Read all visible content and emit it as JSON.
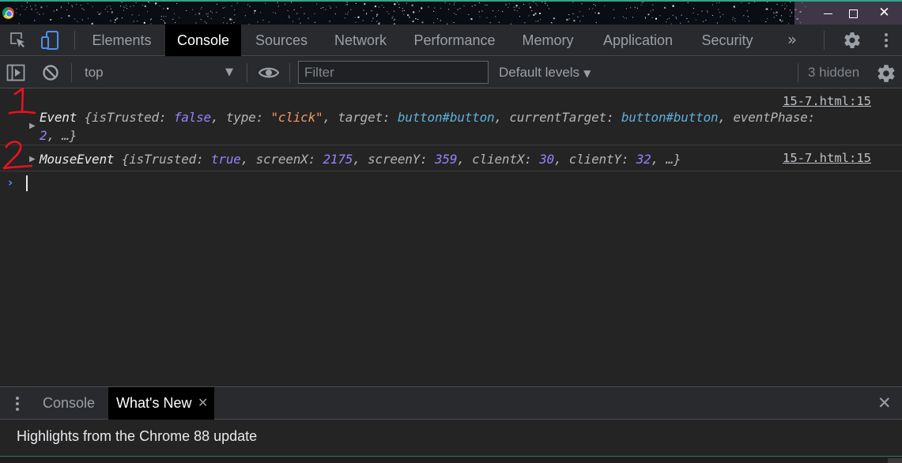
{
  "window": {
    "minimize_icon": "minimize-icon",
    "maximize_icon": "maximize-icon",
    "close_glyph": "✕"
  },
  "tabs": [
    {
      "label": "Elements"
    },
    {
      "label": "Console",
      "active": true
    },
    {
      "label": "Sources"
    },
    {
      "label": "Network"
    },
    {
      "label": "Performance"
    },
    {
      "label": "Memory"
    },
    {
      "label": "Application"
    },
    {
      "label": "Security"
    }
  ],
  "more_tabs_glyph": "»",
  "toolbar": {
    "context": "top",
    "context_arrow": "▼",
    "filter_placeholder": "Filter",
    "filter_value": "",
    "levels_label": "Default levels",
    "levels_caret": "▼",
    "hidden_count": "3 hidden"
  },
  "messages": [
    {
      "source": "15-7.html:15",
      "expand_glyph": "▶",
      "line1": {
        "class_name": "Event",
        "parts": [
          {
            "t": " {",
            "c": "k"
          },
          {
            "t": "isTrusted: ",
            "c": "k"
          },
          {
            "t": "false",
            "c": "f"
          },
          {
            "t": ", type: ",
            "c": "k"
          },
          {
            "t": "\"click\"",
            "c": "s"
          },
          {
            "t": ", target: ",
            "c": "k"
          },
          {
            "t": "button#button",
            "c": "nd"
          },
          {
            "t": ", currentTarget: ",
            "c": "k"
          },
          {
            "t": "button#button",
            "c": "nd"
          },
          {
            "t": ", eventPhase:",
            "c": "k"
          }
        ]
      },
      "line2": {
        "parts": [
          {
            "t": "2",
            "c": "n"
          },
          {
            "t": ", …}",
            "c": "k"
          }
        ]
      }
    },
    {
      "source": "15-7.html:15",
      "expand_glyph": "▶",
      "line1": {
        "class_name": "MouseEvent",
        "parts": [
          {
            "t": " {",
            "c": "k"
          },
          {
            "t": "isTrusted: ",
            "c": "k"
          },
          {
            "t": "true",
            "c": "f"
          },
          {
            "t": ", screenX: ",
            "c": "k"
          },
          {
            "t": "2175",
            "c": "n"
          },
          {
            "t": ", screenY: ",
            "c": "k"
          },
          {
            "t": "359",
            "c": "n"
          },
          {
            "t": ", clientX: ",
            "c": "k"
          },
          {
            "t": "30",
            "c": "n"
          },
          {
            "t": ", clientY: ",
            "c": "k"
          },
          {
            "t": "32",
            "c": "n"
          },
          {
            "t": ", …}",
            "c": "k"
          }
        ]
      }
    }
  ],
  "prompt_glyph": "›",
  "annotations": [
    "1",
    "2"
  ],
  "drawer": {
    "tabs": [
      "Console",
      "What's New"
    ],
    "active_tab": "What's New",
    "tab_close_glyph": "✕",
    "close_glyph": "✕",
    "highlights_text": "Highlights from the Chrome 88 update"
  },
  "colors": {
    "accent_blue": "#4e8ff0",
    "annotation_red": "#e8121e",
    "string": "#f29766",
    "keyword": "#9980ff",
    "node": "#5db0d7"
  }
}
